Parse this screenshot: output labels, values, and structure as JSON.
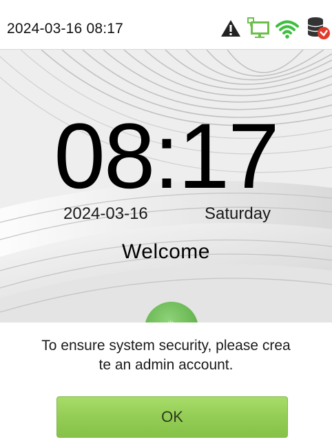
{
  "status_bar": {
    "datetime": "2024-03-16 08:17",
    "icons": [
      "warning-icon",
      "network-computer-icon",
      "wifi-icon",
      "database-icon"
    ],
    "colors": {
      "warning": "#222222",
      "network": "#6cc04a",
      "wifi": "#3fbf3f",
      "database": "#333333",
      "database_badge": "#e23b2a"
    }
  },
  "home": {
    "clock": "08:17",
    "date": "2024-03-16",
    "weekday": "Saturday",
    "welcome": "Welcome",
    "verify_button_icon": "verify-icon"
  },
  "dialog": {
    "message_line1": "To ensure system security, please crea",
    "message_line2": "te an admin account.",
    "ok_label": "OK",
    "accent": "#93cd55"
  }
}
